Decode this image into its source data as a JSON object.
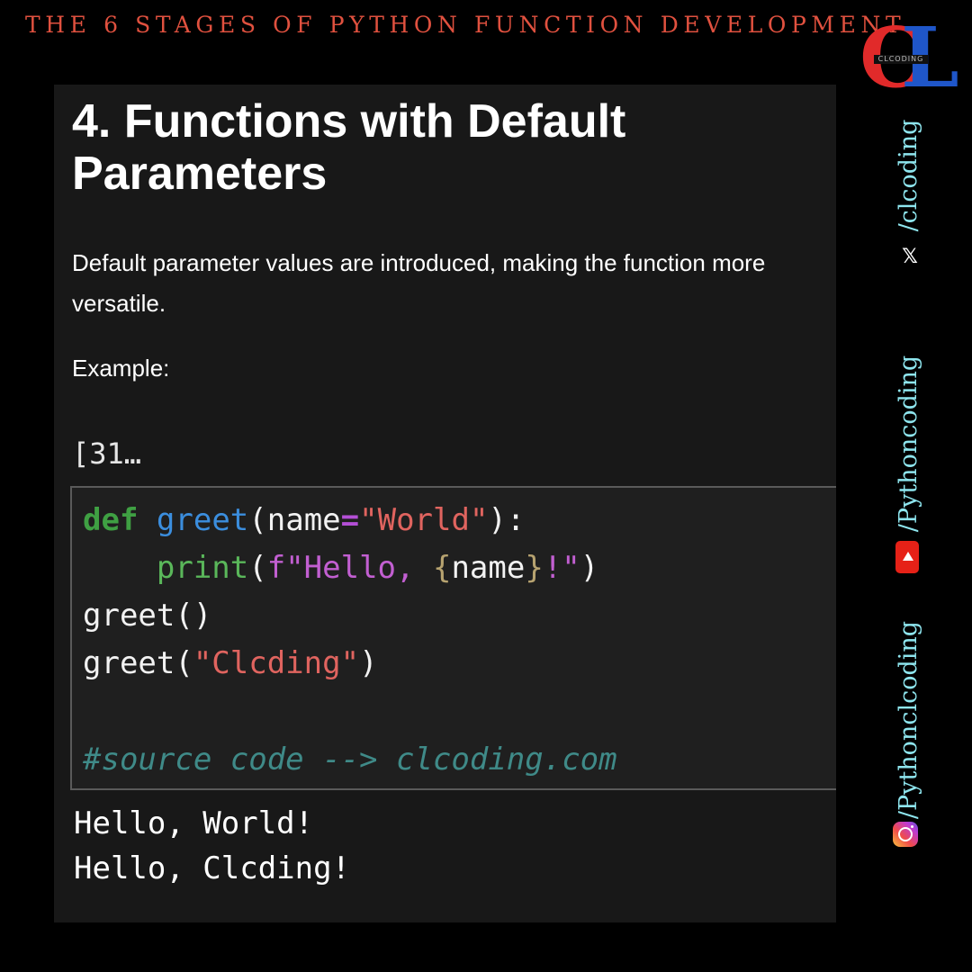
{
  "banner": {
    "title": "THE 6 STAGES OF PYTHON FUNCTION DEVELOPMENT"
  },
  "logo": {
    "left_letter": "C",
    "right_letter": "L",
    "text": "CLCODING"
  },
  "content": {
    "heading": "4. Functions with Default Parameters",
    "paragraph": "Default parameter values are introduced, making the function more versatile.",
    "example_label": "Example:",
    "cell_prompt": "[31…",
    "code": {
      "l1_kw": "def",
      "l1_fn": "greet",
      "l1_open": "(",
      "l1_param": "name",
      "l1_eq": "=",
      "l1_str": "\"World\"",
      "l1_close": "):",
      "l2_indent": "    ",
      "l2_fn": "print",
      "l2_open": "(",
      "l2_fstr_start": "f\"Hello, ",
      "l2_brace_open": "{",
      "l2_var": "name",
      "l2_brace_close": "}",
      "l2_fstr_end": "!\"",
      "l2_close": ")",
      "l3": "greet()",
      "l4_fn": "greet(",
      "l4_str": "\"Clcding\"",
      "l4_close": ")",
      "comment": "#source code --> clcoding.com"
    },
    "output": [
      "Hello, World!",
      "Hello, Clcding!"
    ]
  },
  "social": {
    "twitter_handle": "/clcoding",
    "twitter_icon": "x-icon",
    "youtube_handle": "/Pythoncoding",
    "youtube_icon": "youtube-icon",
    "instagram_handle": "/Pythonclcoding",
    "instagram_icon": "instagram-icon"
  },
  "colors": {
    "banner": "#e0513f",
    "social_text": "#8ee5ee",
    "logo_red": "#e12a2a",
    "logo_blue": "#1f56c9"
  }
}
